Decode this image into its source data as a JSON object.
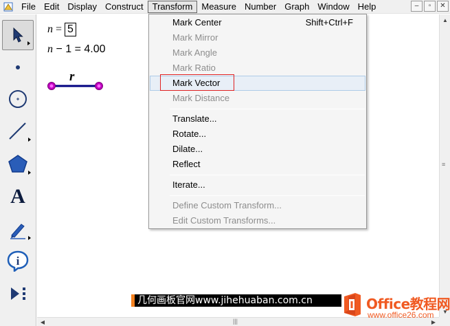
{
  "menubar": {
    "items": [
      {
        "label": "File"
      },
      {
        "label": "Edit"
      },
      {
        "label": "Display"
      },
      {
        "label": "Construct"
      },
      {
        "label": "Transform"
      },
      {
        "label": "Measure"
      },
      {
        "label": "Number"
      },
      {
        "label": "Graph"
      },
      {
        "label": "Window"
      },
      {
        "label": "Help"
      }
    ],
    "active": "Transform"
  },
  "window_controls": {
    "minimize": "–",
    "restore": "▫",
    "close": "✕"
  },
  "toolbox": {
    "tools": [
      {
        "name": "arrow-tool",
        "icon": "arrow-select-icon",
        "selected": true
      },
      {
        "name": "point-tool",
        "icon": "point-icon"
      },
      {
        "name": "compass-tool",
        "icon": "circle-icon"
      },
      {
        "name": "straightedge-tool",
        "icon": "segment-icon"
      },
      {
        "name": "polygon-tool",
        "icon": "polygon-icon"
      },
      {
        "name": "text-tool",
        "icon": "text-a-icon"
      },
      {
        "name": "marker-tool",
        "icon": "pen-icon"
      },
      {
        "name": "information-tool",
        "icon": "info-icon"
      },
      {
        "name": "custom-tool",
        "icon": "custom-tool-icon"
      }
    ],
    "text_tool_glyph": "A"
  },
  "canvas": {
    "param_var": "n",
    "param_eq": " = ",
    "param_value": "5",
    "calc_var": "n",
    "calc_expr": " − 1 = 4.00",
    "segment_label": "r",
    "segment_color": "#000080",
    "point_color": "#c000c0"
  },
  "transform_menu": {
    "items": [
      {
        "label": "Mark Center",
        "shortcut": "Shift+Ctrl+F",
        "enabled": true
      },
      {
        "label": "Mark Mirror",
        "enabled": false
      },
      {
        "label": "Mark Angle",
        "enabled": false
      },
      {
        "label": "Mark Ratio",
        "enabled": false
      },
      {
        "label": "Mark Vector",
        "enabled": true,
        "hover": true
      },
      {
        "label": "Mark Distance",
        "enabled": false
      },
      {
        "label": "Translate...",
        "enabled": true
      },
      {
        "label": "Rotate...",
        "enabled": true
      },
      {
        "label": "Dilate...",
        "enabled": true
      },
      {
        "label": "Reflect",
        "enabled": true
      },
      {
        "label": "Iterate...",
        "enabled": true
      },
      {
        "label": "Define Custom Transform...",
        "enabled": false
      },
      {
        "label": "Edit Custom Transforms...",
        "enabled": false
      }
    ],
    "highlight_color": "#e02020"
  },
  "watermarks": {
    "left_text": "几何画板官网www.jihehuaban.com.cn",
    "right_title": "Office教程网",
    "right_url": "www.office26.com",
    "accent": "#f05a22"
  }
}
